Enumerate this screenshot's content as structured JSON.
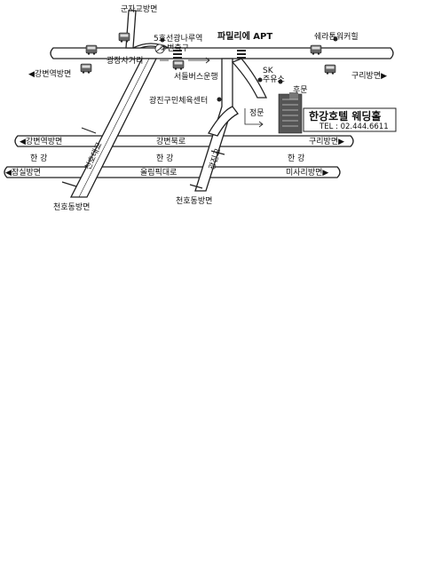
{
  "map": {
    "places": {
      "gunja": "군자교방면",
      "station_line1": "5호선광나루역",
      "station_line2": "②번출구",
      "family_apt": "파밀리에 APT",
      "sheraton": "쉐라톤워커힐",
      "gangbyeon_station": "◀강변역방면",
      "guri_top": "구리방면▶",
      "gwangjang": "광장사거리",
      "seoul_bus": "서들버스운행",
      "sk_gas1": "SK",
      "sk_gas2": "주유소",
      "back_gate": "후문",
      "gym": "광진구민체육센터",
      "main_gate": "정문",
      "hotel_name": "한강호텔 웨딩홀",
      "hotel_tel": "TEL : 02.444.6611",
      "gangbyeon_dir": "◀강변역방면",
      "gangbyeon_north": "강변북로",
      "guri_mid": "구리방면▶",
      "han1": "한 강",
      "han2": "한 강",
      "han3": "한 강",
      "jamsil": "◀잠실방면",
      "olympic": "올림픽대로",
      "misari": "미사리방면▶",
      "cheonho_left": "천호동방면",
      "cheonho_right": "천호동방면",
      "bridge1": "천호대교",
      "bridge2": "광진교"
    },
    "icons": {
      "bus": "bus-icon",
      "building": "hotel-building-icon",
      "poi": "poi-dot-icon",
      "subway": "subway-icon"
    }
  }
}
